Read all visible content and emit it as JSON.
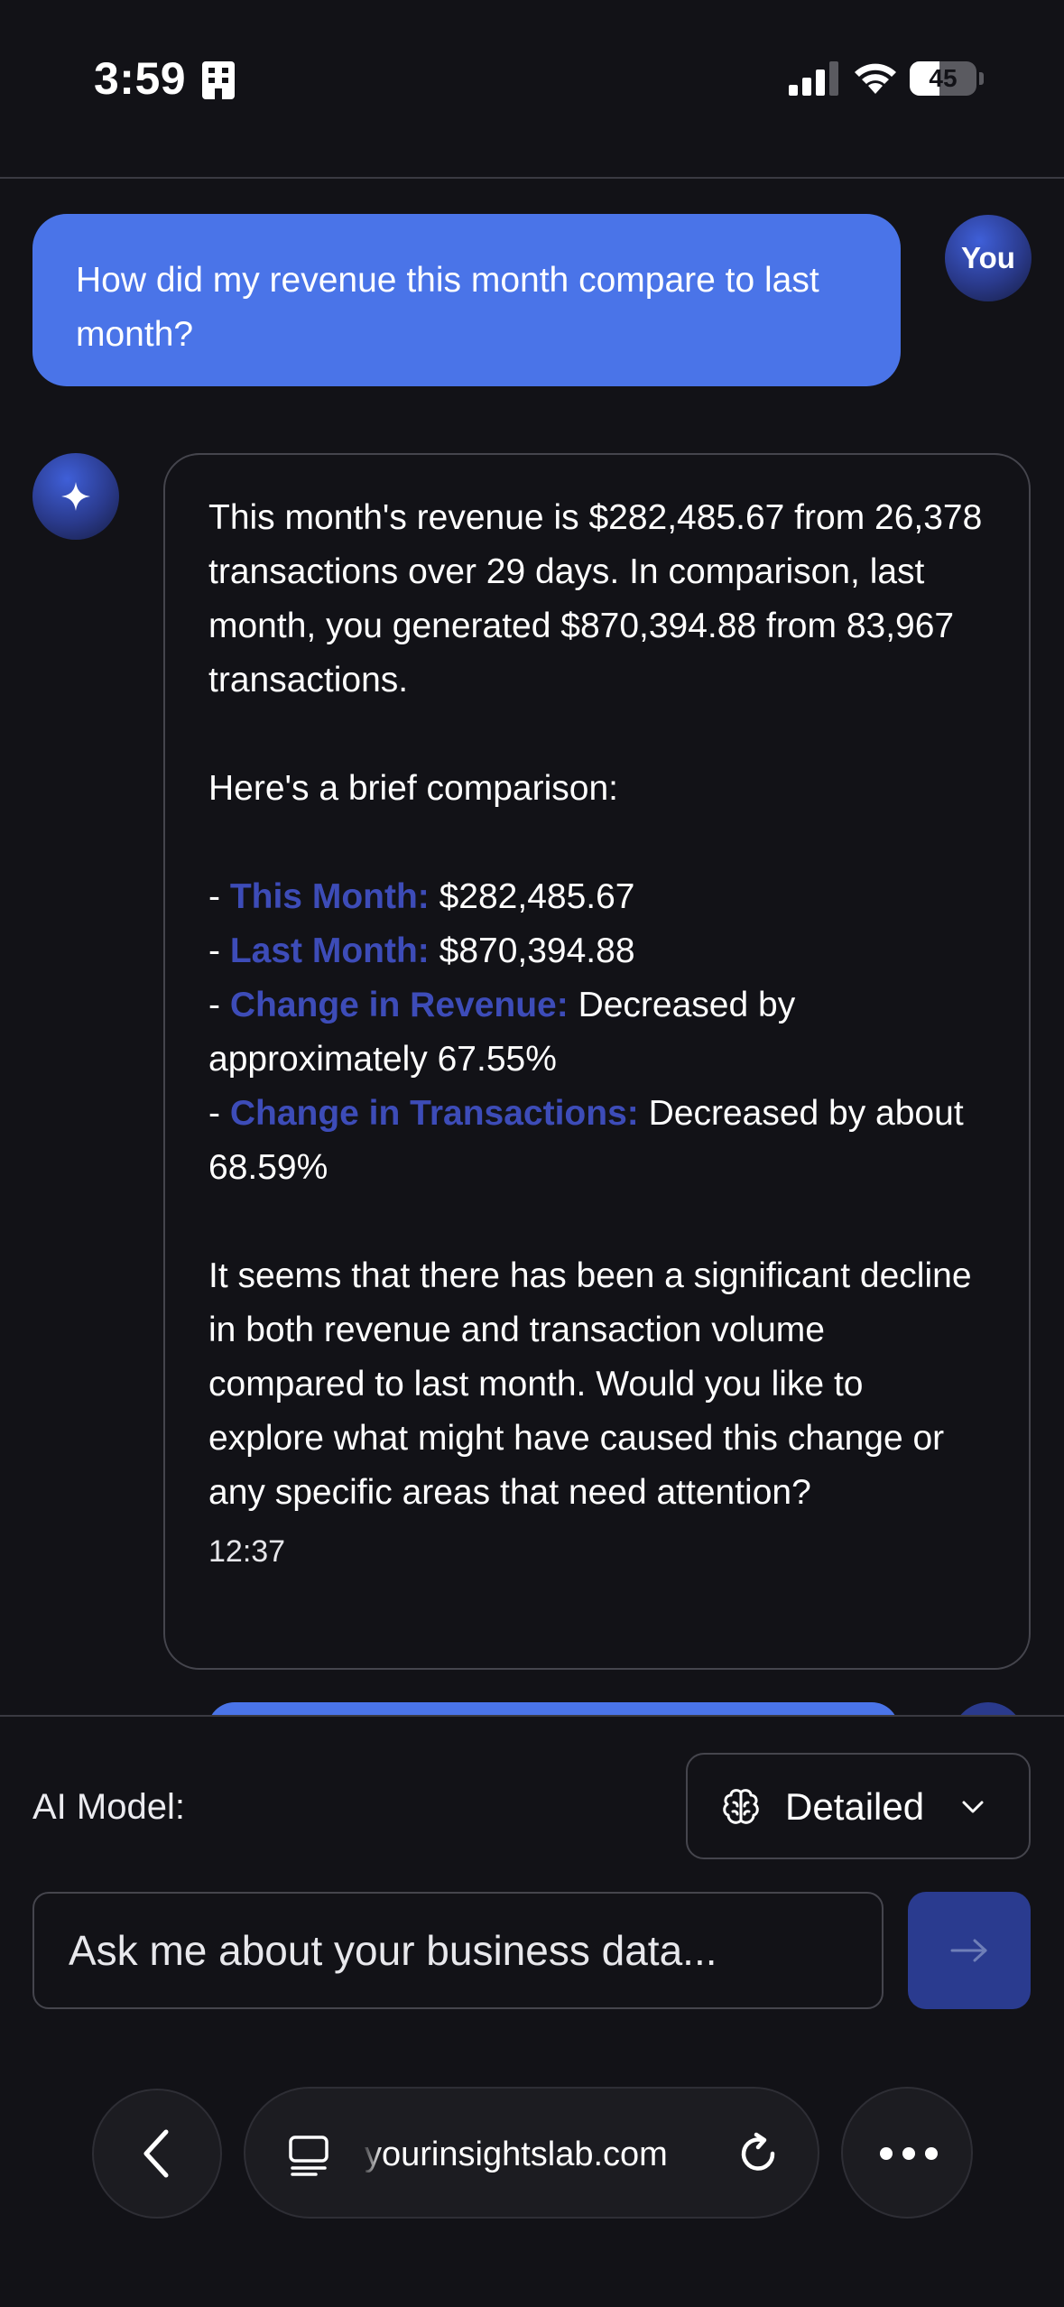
{
  "status_bar": {
    "time": "3:59",
    "battery_percent": "45",
    "battery_level": 0.45
  },
  "chat": {
    "user_message": {
      "text": "How did my revenue this month compare to last month?",
      "avatar_label": "You"
    },
    "ai_message": {
      "intro": "This month's revenue is $282,485.67 from 26,378 transactions over 29 days. In comparison, last month, you generated $870,394.88 from 83,967 transactions.",
      "lead": "Here's a brief comparison:",
      "items": [
        {
          "label": "This Month:",
          "value": "$282,485.67"
        },
        {
          "label": "Last Month:",
          "value": "$870,394.88"
        },
        {
          "label": "Change in Revenue:",
          "value": "Decreased by approximately 67.55%"
        },
        {
          "label": "Change in Transactions:",
          "value": "Decreased by about 68.59%"
        }
      ],
      "closing": "It seems that there has been a significant decline in both revenue and transaction volume compared to last month. Would you like to explore what might have caused this change or any specific areas that need attention?",
      "time": "12:37"
    }
  },
  "controls": {
    "model_label": "AI Model:",
    "model_value": "Detailed",
    "input_placeholder": "Ask me about your business data..."
  },
  "browser": {
    "url": "yourinsightslab.com"
  },
  "colors": {
    "background": "#121217",
    "user_bubble": "#4a74e8",
    "highlight": "#3d4cb8",
    "send_button": "#2a3b8f"
  }
}
